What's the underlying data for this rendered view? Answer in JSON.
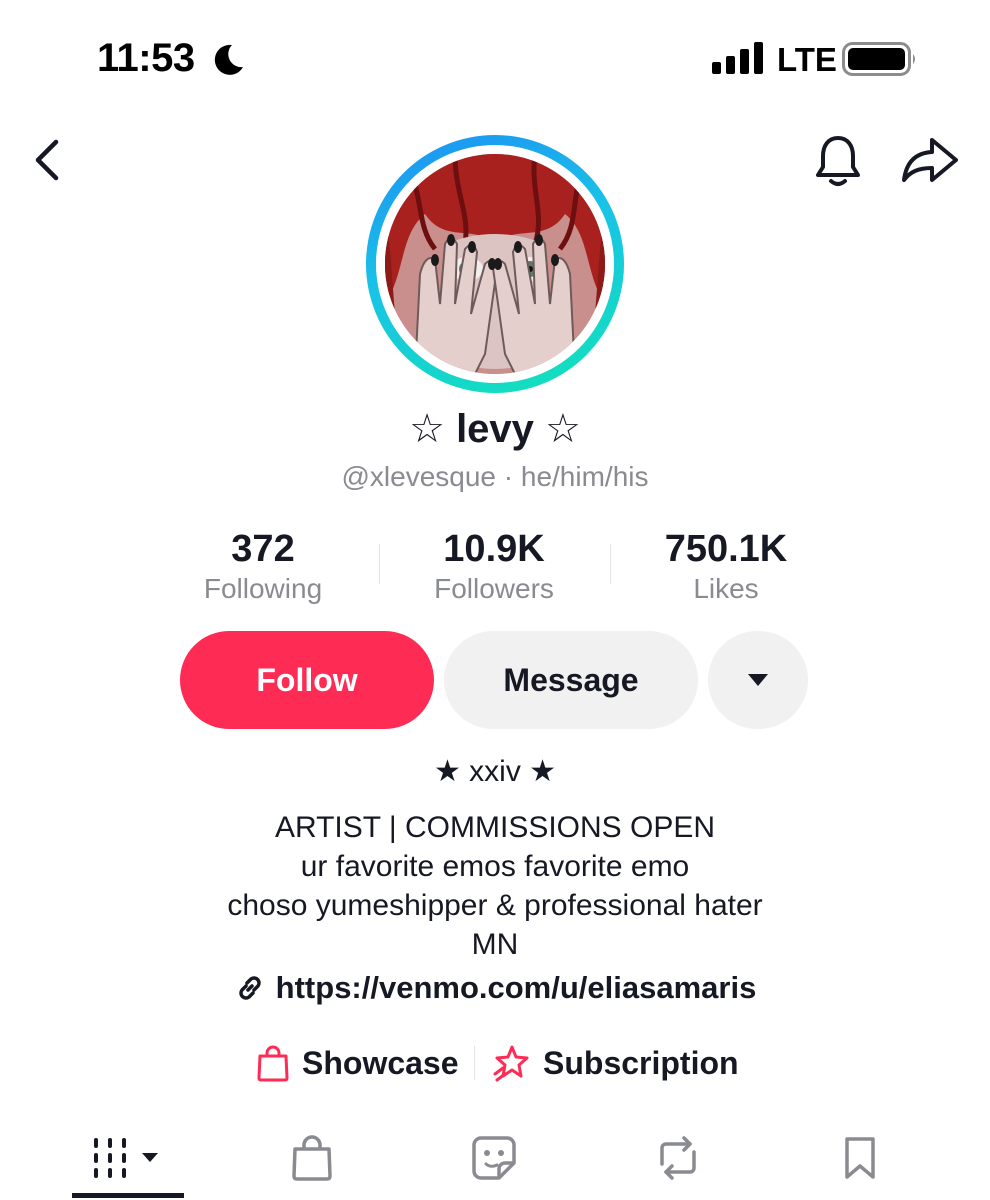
{
  "status_bar": {
    "time": "11:53",
    "moon_icon": "moon-icon",
    "signal_icon": "cellular-signal-icon",
    "network": "LTE",
    "battery_icon": "battery-icon"
  },
  "nav": {
    "back_icon": "chevron-left-icon",
    "bell_icon": "bell-icon",
    "share_icon": "share-arrow-icon"
  },
  "profile": {
    "display_name": "☆ levy ☆",
    "handle": "@xlevesque",
    "pronouns_line": "@xlevesque · he/him/his",
    "avatar_description_icon": "avatar"
  },
  "stats": [
    {
      "value": "372",
      "label": "Following"
    },
    {
      "value": "10.9K",
      "label": "Followers"
    },
    {
      "value": "750.1K",
      "label": "Likes"
    }
  ],
  "actions": {
    "follow_label": "Follow",
    "message_label": "Message",
    "more_icon": "caret-down-icon"
  },
  "bio": {
    "lines": [
      "★ xxiv ★",
      "ARTIST | COMMISSIONS OPEN",
      "ur favorite emos favorite emo",
      "choso yumeshipper & professional hater",
      "MN"
    ],
    "link_icon": "link-icon",
    "link": "https://venmo.com/u/eliasamaris"
  },
  "pills": {
    "showcase_label": "Showcase",
    "showcase_icon": "shopping-bag-icon",
    "subscription_label": "Subscription",
    "subscription_icon": "subscription-star-icon"
  },
  "tabs": [
    {
      "icon": "grid-icon",
      "active": true
    },
    {
      "icon": "shopping-bag-icon",
      "active": false
    },
    {
      "icon": "sticker-icon",
      "active": false
    },
    {
      "icon": "repost-icon",
      "active": false
    },
    {
      "icon": "bookmark-icon",
      "active": false
    }
  ],
  "colors": {
    "accent": "#fe2c55",
    "ring_start": "#1e8ef5",
    "ring_end": "#11e4b6",
    "secondary_text": "#8a8b91",
    "button_gray": "#f1f1f2"
  }
}
